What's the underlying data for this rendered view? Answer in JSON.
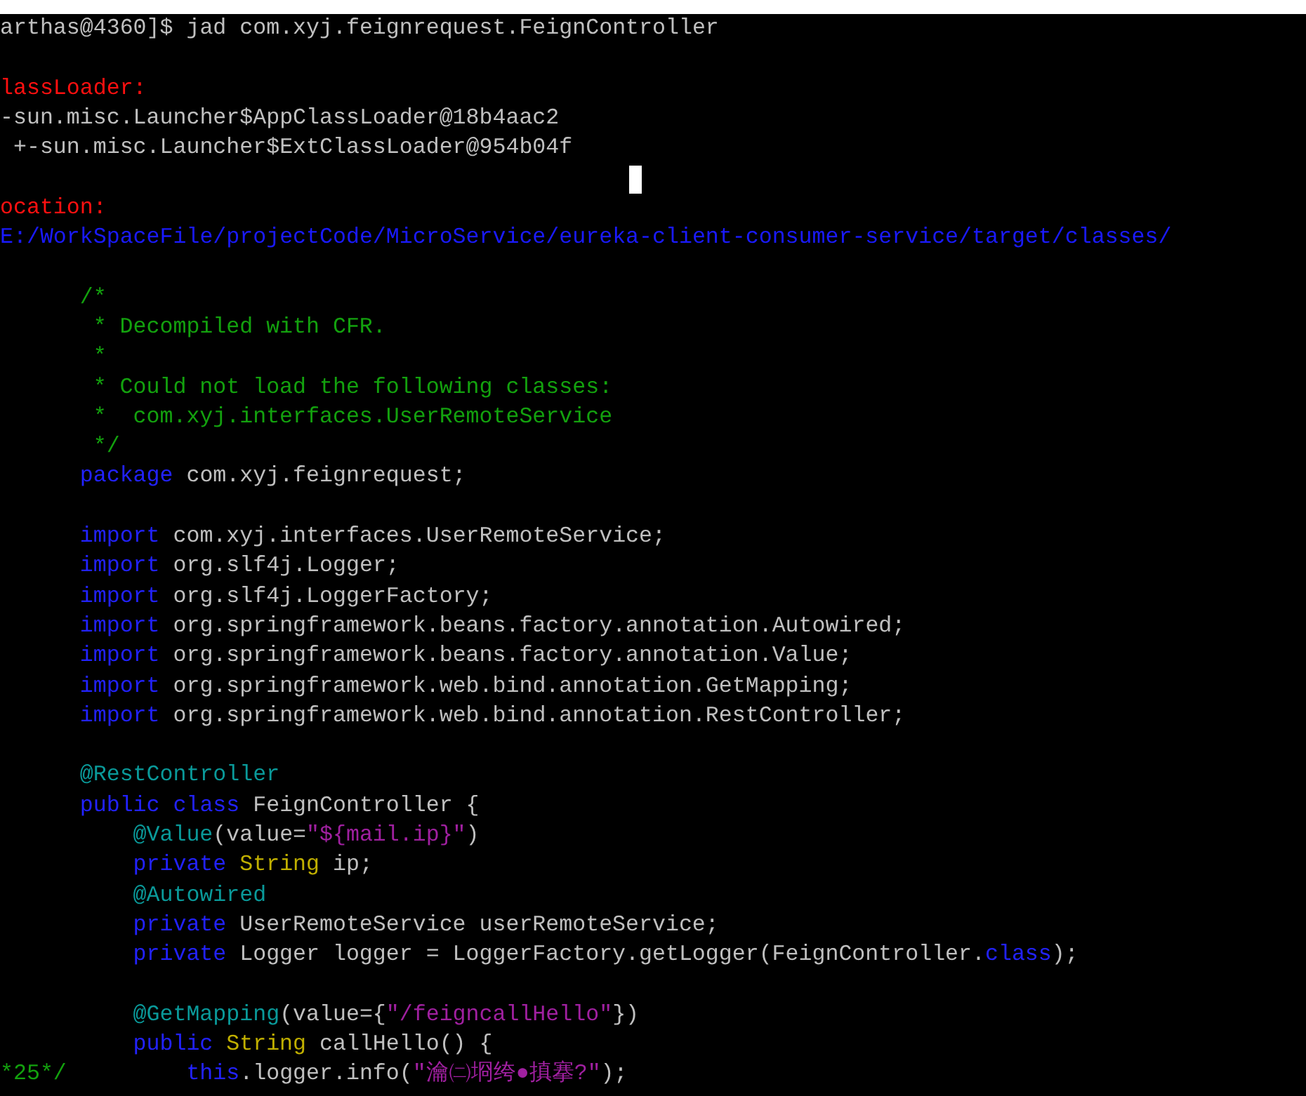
{
  "terminal": {
    "lines": [
      {
        "kind": "top",
        "segments": [
          {
            "kind": "plain",
            "text": "arthas@4360]$ jad com.xyj.feignrequest.FeignController"
          }
        ]
      },
      {
        "kind": "top",
        "blank_before": true,
        "segments": [
          {
            "kind": "label",
            "text": "lassLoader:"
          }
        ]
      },
      {
        "kind": "top",
        "segments": [
          {
            "kind": "plain",
            "text": "-sun.misc.Launcher$AppClassLoader@18b4aac2"
          }
        ]
      },
      {
        "kind": "top",
        "segments": [
          {
            "kind": "plain",
            "text": " +-sun.misc.Launcher$ExtClassLoader@954b04f"
          }
        ]
      },
      {
        "kind": "top",
        "blank_before": true,
        "segments": [
          {
            "kind": "label",
            "text": "ocation:"
          }
        ]
      },
      {
        "kind": "top",
        "segments": [
          {
            "kind": "path",
            "text": "E:/WorkSpaceFile/projectCode/MicroService/eureka-client-consumer-service/target/classes/"
          }
        ]
      },
      {
        "kind": "outer",
        "blank_before": true,
        "segments": [
          {
            "kind": "comment",
            "text": "/*"
          }
        ]
      },
      {
        "kind": "comment",
        "segments": [
          {
            "kind": "comment",
            "text": "* Decompiled with CFR."
          }
        ]
      },
      {
        "kind": "comment",
        "segments": [
          {
            "kind": "comment",
            "text": "*"
          }
        ]
      },
      {
        "kind": "comment",
        "segments": [
          {
            "kind": "comment",
            "text": "* Could not load the following classes:"
          }
        ]
      },
      {
        "kind": "comment",
        "segments": [
          {
            "kind": "comment",
            "text": "*  com.xyj.interfaces.UserRemoteService"
          }
        ]
      },
      {
        "kind": "comment",
        "segments": [
          {
            "kind": "comment",
            "text": "*/"
          }
        ]
      },
      {
        "kind": "outer",
        "segments": [
          {
            "kind": "keyword",
            "text": "package"
          },
          {
            "kind": "plain",
            "text": " com.xyj.feignrequest;"
          }
        ]
      },
      {
        "kind": "outer",
        "blank_before": true,
        "segments": [
          {
            "kind": "keyword",
            "text": "import"
          },
          {
            "kind": "plain",
            "text": " com.xyj.interfaces.UserRemoteService;"
          }
        ]
      },
      {
        "kind": "outer",
        "segments": [
          {
            "kind": "keyword",
            "text": "import"
          },
          {
            "kind": "plain",
            "text": " org.slf4j.Logger;"
          }
        ]
      },
      {
        "kind": "outer",
        "segments": [
          {
            "kind": "keyword",
            "text": "import"
          },
          {
            "kind": "plain",
            "text": " org.slf4j.LoggerFactory;"
          }
        ]
      },
      {
        "kind": "outer",
        "segments": [
          {
            "kind": "keyword",
            "text": "import"
          },
          {
            "kind": "plain",
            "text": " org.springframework.beans.factory.annotation.Autowired;"
          }
        ]
      },
      {
        "kind": "outer",
        "segments": [
          {
            "kind": "keyword",
            "text": "import"
          },
          {
            "kind": "plain",
            "text": " org.springframework.beans.factory.annotation.Value;"
          }
        ]
      },
      {
        "kind": "outer",
        "segments": [
          {
            "kind": "keyword",
            "text": "import"
          },
          {
            "kind": "plain",
            "text": " org.springframework.web.bind.annotation.GetMapping;"
          }
        ]
      },
      {
        "kind": "outer",
        "segments": [
          {
            "kind": "keyword",
            "text": "import"
          },
          {
            "kind": "plain",
            "text": " org.springframework.web.bind.annotation.RestController;"
          }
        ]
      },
      {
        "kind": "outer",
        "blank_before": true,
        "segments": [
          {
            "kind": "annotation",
            "text": "@RestController"
          }
        ]
      },
      {
        "kind": "outer",
        "segments": [
          {
            "kind": "keyword",
            "text": "public class"
          },
          {
            "kind": "plain",
            "text": " FeignController {"
          }
        ]
      },
      {
        "kind": "member",
        "segments": [
          {
            "kind": "annotation",
            "text": "@Value"
          },
          {
            "kind": "plain",
            "text": "(value="
          },
          {
            "kind": "string",
            "text": "\"${mail.ip}\""
          },
          {
            "kind": "plain",
            "text": ")"
          }
        ]
      },
      {
        "kind": "member",
        "segments": [
          {
            "kind": "keyword",
            "text": "private "
          },
          {
            "kind": "type",
            "text": "String"
          },
          {
            "kind": "plain",
            "text": " ip;"
          }
        ]
      },
      {
        "kind": "member",
        "segments": [
          {
            "kind": "annotation",
            "text": "@Autowired"
          }
        ]
      },
      {
        "kind": "member",
        "segments": [
          {
            "kind": "keyword",
            "text": "private"
          },
          {
            "kind": "plain",
            "text": " UserRemoteService userRemoteService;"
          }
        ]
      },
      {
        "kind": "member",
        "segments": [
          {
            "kind": "keyword",
            "text": "private"
          },
          {
            "kind": "plain",
            "text": " Logger logger = LoggerFactory.getLogger(FeignController."
          },
          {
            "kind": "keyword",
            "text": "class"
          },
          {
            "kind": "plain",
            "text": ");"
          }
        ]
      },
      {
        "kind": "member",
        "blank_before": true,
        "segments": [
          {
            "kind": "annotation",
            "text": "@GetMapping"
          },
          {
            "kind": "plain",
            "text": "(value={"
          },
          {
            "kind": "string",
            "text": "\"/feigncallHello\""
          },
          {
            "kind": "plain",
            "text": "})"
          }
        ]
      },
      {
        "kind": "member",
        "segments": [
          {
            "kind": "keyword",
            "text": "public "
          },
          {
            "kind": "type",
            "text": "String"
          },
          {
            "kind": "plain",
            "text": " callHello() {"
          }
        ]
      },
      {
        "kind": "top",
        "segments": [
          {
            "kind": "margin_comment",
            "text": "*25*/"
          },
          {
            "kind": "keyword",
            "text": "this"
          },
          {
            "kind": "plain",
            "text": ".logger.info("
          },
          {
            "kind": "string",
            "text": "\"瀹㈡埛绔●搷搴?\""
          },
          {
            "kind": "plain",
            "text": ");"
          }
        ]
      }
    ]
  }
}
